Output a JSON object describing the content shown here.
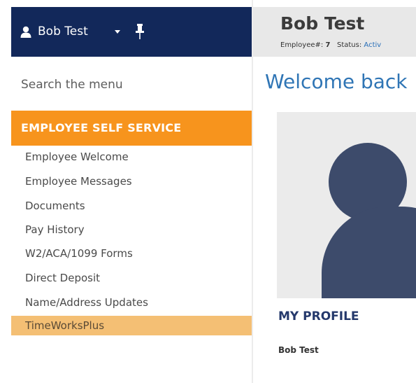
{
  "user_bar": {
    "user_name": "Bob Test",
    "icons": [
      "user-icon",
      "caret-down-icon",
      "pin-icon"
    ]
  },
  "sidebar": {
    "search_placeholder": "Search the menu",
    "section_title": "EMPLOYEE SELF SERVICE",
    "items": [
      {
        "label": "Employee Welcome"
      },
      {
        "label": "Employee Messages"
      },
      {
        "label": "Documents"
      },
      {
        "label": "Pay History"
      },
      {
        "label": "W2/ACA/1099 Forms"
      },
      {
        "label": "Direct Deposit"
      },
      {
        "label": "Name/Address Updates"
      },
      {
        "label": "TimeWorksPlus",
        "active": true
      }
    ]
  },
  "header": {
    "employee_name": "Bob Test",
    "employee_number_label": "Employee#:",
    "employee_number": "7",
    "status_label": "Status:",
    "status_value": "Activ"
  },
  "main": {
    "welcome_text": "Welcome back",
    "profile_title": "MY PROFILE",
    "profile_name": "Bob Test"
  },
  "colors": {
    "user_bar_bg": "#12285a",
    "section_header_bg": "#f7941d",
    "active_item_bg": "#f4bf74",
    "welcome_text": "#2f75b5",
    "profile_title": "#24386b",
    "avatar_silhouette": "#3d4b6b"
  }
}
